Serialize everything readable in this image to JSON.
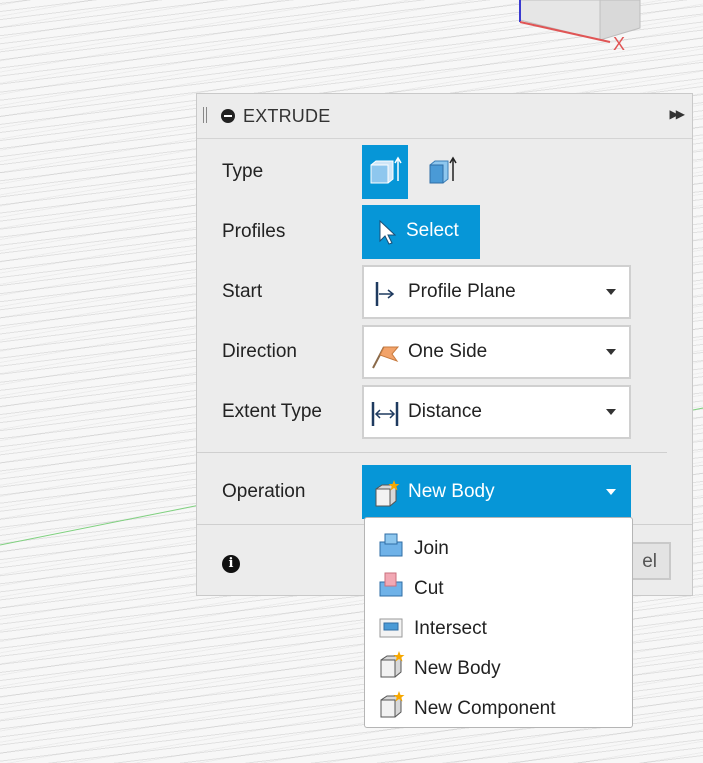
{
  "viewport": {
    "axis_label": "X"
  },
  "panel": {
    "title": "EXTRUDE",
    "rows": {
      "type": {
        "label": "Type"
      },
      "profiles": {
        "label": "Profiles",
        "button": "Select"
      },
      "start": {
        "label": "Start",
        "value": "Profile Plane"
      },
      "direction": {
        "label": "Direction",
        "value": "One Side"
      },
      "extent_type": {
        "label": "Extent Type",
        "value": "Distance"
      },
      "operation": {
        "label": "Operation",
        "value": "New Body"
      }
    },
    "footer": {
      "cancel_partial": "el"
    }
  },
  "operation_menu": {
    "items": [
      {
        "label": "Join",
        "icon": "join-icon"
      },
      {
        "label": "Cut",
        "icon": "cut-icon"
      },
      {
        "label": "Intersect",
        "icon": "intersect-icon"
      },
      {
        "label": "New Body",
        "icon": "new-body-icon"
      },
      {
        "label": "New Component",
        "icon": "new-component-icon"
      }
    ]
  },
  "colors": {
    "accent": "#0696d7",
    "panel_bg": "#ececec",
    "highlight_star": "#f7a800"
  }
}
